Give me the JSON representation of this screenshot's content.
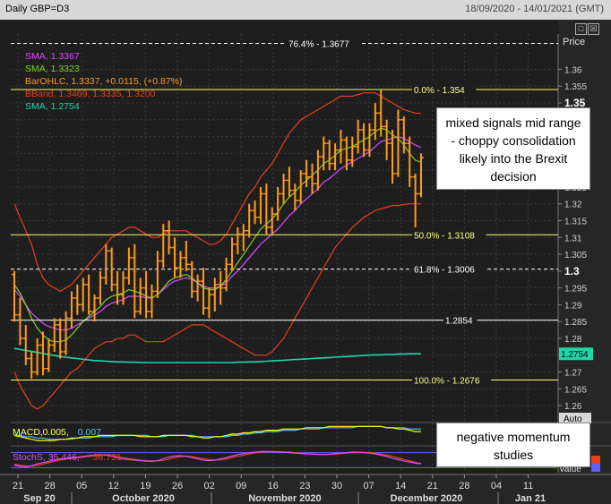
{
  "header": {
    "title": "Daily GBP=D3",
    "date_range": "18/09/2020 - 14/01/2021 (GMT)"
  },
  "window_buttons": [
    "□",
    "☒"
  ],
  "annotations": {
    "main": "mixed signals mid range - choppy consolidation likely into the Brexit decision",
    "momentum": "negative momentum studies"
  },
  "colors": {
    "background": "#1e1e1e",
    "grid": "#3a3a3a",
    "candle": "#ff9a1a",
    "sma_fast": "#d94cff",
    "sma_slow": "#7fd327",
    "sma_long": "#1fd6a8",
    "bband": "#e8401c",
    "fib_line": "#ffff66",
    "macd": "#ffff00",
    "macd_signal": "#4fc3f7",
    "stoch_k": "#d94cff",
    "stoch_d": "#e8401c"
  },
  "chart_data": {
    "type": "candlestick",
    "title": "Daily GBP=D3",
    "ylabel": "Price",
    "ylim": [
      1.2555,
      1.3705
    ],
    "y_ticks": [
      1.26,
      1.265,
      1.27,
      1.275,
      1.28,
      1.285,
      1.29,
      1.295,
      1.3,
      1.305,
      1.31,
      1.315,
      1.32,
      1.325,
      1.33,
      1.335,
      1.34,
      1.345,
      1.35,
      1.355,
      1.36
    ],
    "y_ticks_labels": [
      "1.26",
      "1.265",
      "1.27",
      "1.275",
      "1.28",
      "1.285",
      "1.29",
      "1.295",
      "1.3",
      "1.305",
      "1.31",
      "1.315",
      "1.32",
      "1.325",
      "1.33",
      "1.335",
      "1.34",
      "1.345",
      "1.35",
      "1.355",
      "1.36"
    ],
    "y_ticks_bold": [
      "1.3",
      "1.35"
    ],
    "x_ticks": [
      "21",
      "28",
      "05",
      "12",
      "19",
      "26",
      "02",
      "09",
      "16",
      "23",
      "30",
      "07",
      "14",
      "21",
      "28",
      "04",
      "11"
    ],
    "x_months": [
      "Sep 20",
      "October 2020",
      "November 2020",
      "December 2020",
      "Jan 21"
    ],
    "legend": [
      {
        "label": "SMA, 1.3367",
        "color": "#d94cff"
      },
      {
        "label": "SMA, 1.3323",
        "color": "#7fd327"
      },
      {
        "label": "BarOHLC, 1.3337, +0.0115, (+0.87%)",
        "color": "#ff9a1a"
      },
      {
        "label": "BBand, 1.3469, 1.3335, 1.3200",
        "color": "#e8401c"
      },
      {
        "label": "SMA, 1.2754",
        "color": "#1fd6a8"
      }
    ],
    "horizontal_levels": [
      {
        "label": "76.4% - 1.3677",
        "value": 1.3677,
        "color": "#ffffff",
        "dashed": true
      },
      {
        "label": "0.0% - 1.354",
        "value": 1.354,
        "color": "#ffff66",
        "dashed": false
      },
      {
        "label": "50.0% - 1.3108",
        "value": 1.3108,
        "color": "#ffff66",
        "dashed": false
      },
      {
        "label": "61.8% - 1.3006",
        "value": 1.3006,
        "color": "#ffffff",
        "dashed": true
      },
      {
        "label": "1.2854",
        "value": 1.2854,
        "color": "#ffffff",
        "dashed": false
      },
      {
        "label": "100.0% - 1.2676",
        "value": 1.2676,
        "color": "#ffff66",
        "dashed": false
      }
    ],
    "last_value_tag": {
      "label": "1.2754",
      "value": 1.2754
    },
    "ohlc": [
      [
        1.299,
        1.3,
        1.285,
        1.287
      ],
      [
        1.287,
        1.292,
        1.278,
        1.28
      ],
      [
        1.28,
        1.284,
        1.272,
        1.274
      ],
      [
        1.274,
        1.276,
        1.268,
        1.27
      ],
      [
        1.27,
        1.28,
        1.269,
        1.278
      ],
      [
        1.278,
        1.282,
        1.269,
        1.271
      ],
      [
        1.271,
        1.28,
        1.27,
        1.278
      ],
      [
        1.278,
        1.286,
        1.276,
        1.284
      ],
      [
        1.284,
        1.286,
        1.274,
        1.276
      ],
      [
        1.276,
        1.288,
        1.275,
        1.286
      ],
      [
        1.286,
        1.294,
        1.283,
        1.292
      ],
      [
        1.292,
        1.296,
        1.287,
        1.29
      ],
      [
        1.29,
        1.298,
        1.288,
        1.296
      ],
      [
        1.296,
        1.299,
        1.287,
        1.288
      ],
      [
        1.288,
        1.293,
        1.285,
        1.292
      ],
      [
        1.292,
        1.3,
        1.29,
        1.298
      ],
      [
        1.298,
        1.308,
        1.296,
        1.306
      ],
      [
        1.306,
        1.307,
        1.294,
        1.296
      ],
      [
        1.296,
        1.3,
        1.29,
        1.293
      ],
      [
        1.293,
        1.3,
        1.29,
        1.298
      ],
      [
        1.298,
        1.307,
        1.296,
        1.304
      ],
      [
        1.304,
        1.308,
        1.286,
        1.288
      ],
      [
        1.288,
        1.298,
        1.287,
        1.295
      ],
      [
        1.295,
        1.3,
        1.286,
        1.288
      ],
      [
        1.288,
        1.296,
        1.286,
        1.294
      ],
      [
        1.294,
        1.306,
        1.292,
        1.303
      ],
      [
        1.303,
        1.314,
        1.301,
        1.312
      ],
      [
        1.312,
        1.315,
        1.305,
        1.307
      ],
      [
        1.307,
        1.31,
        1.298,
        1.301
      ],
      [
        1.301,
        1.306,
        1.298,
        1.304
      ],
      [
        1.304,
        1.309,
        1.3,
        1.302
      ],
      [
        1.302,
        1.303,
        1.292,
        1.294
      ],
      [
        1.294,
        1.299,
        1.291,
        1.297
      ],
      [
        1.297,
        1.301,
        1.287,
        1.289
      ],
      [
        1.289,
        1.295,
        1.286,
        1.293
      ],
      [
        1.293,
        1.298,
        1.288,
        1.296
      ],
      [
        1.296,
        1.3,
        1.29,
        1.295
      ],
      [
        1.295,
        1.304,
        1.294,
        1.302
      ],
      [
        1.302,
        1.31,
        1.3,
        1.308
      ],
      [
        1.308,
        1.313,
        1.305,
        1.311
      ],
      [
        1.311,
        1.314,
        1.306,
        1.312
      ],
      [
        1.312,
        1.32,
        1.31,
        1.318
      ],
      [
        1.318,
        1.321,
        1.314,
        1.316
      ],
      [
        1.316,
        1.325,
        1.314,
        1.323
      ],
      [
        1.323,
        1.326,
        1.311,
        1.313
      ],
      [
        1.313,
        1.319,
        1.311,
        1.317
      ],
      [
        1.317,
        1.325,
        1.315,
        1.323
      ],
      [
        1.323,
        1.329,
        1.32,
        1.327
      ],
      [
        1.327,
        1.331,
        1.322,
        1.324
      ],
      [
        1.324,
        1.326,
        1.318,
        1.321
      ],
      [
        1.321,
        1.33,
        1.32,
        1.329
      ],
      [
        1.329,
        1.333,
        1.325,
        1.328
      ],
      [
        1.328,
        1.332,
        1.323,
        1.326
      ],
      [
        1.326,
        1.336,
        1.324,
        1.334
      ],
      [
        1.334,
        1.34,
        1.33,
        1.338
      ],
      [
        1.338,
        1.339,
        1.33,
        1.332
      ],
      [
        1.332,
        1.338,
        1.33,
        1.336
      ],
      [
        1.336,
        1.342,
        1.332,
        1.339
      ],
      [
        1.339,
        1.34,
        1.33,
        1.333
      ],
      [
        1.333,
        1.34,
        1.331,
        1.337
      ],
      [
        1.337,
        1.345,
        1.335,
        1.342
      ],
      [
        1.342,
        1.344,
        1.334,
        1.336
      ],
      [
        1.336,
        1.344,
        1.334,
        1.342
      ],
      [
        1.342,
        1.35,
        1.339,
        1.347
      ],
      [
        1.347,
        1.354,
        1.34,
        1.343
      ],
      [
        1.343,
        1.345,
        1.333,
        1.338
      ],
      [
        1.338,
        1.342,
        1.326,
        1.329
      ],
      [
        1.329,
        1.348,
        1.328,
        1.345
      ],
      [
        1.345,
        1.346,
        1.335,
        1.338
      ],
      [
        1.338,
        1.34,
        1.325,
        1.328
      ],
      [
        1.328,
        1.329,
        1.313,
        1.323
      ],
      [
        1.323,
        1.335,
        1.322,
        1.3337
      ]
    ],
    "sma_fast": [
      1.2945,
      1.2925,
      1.29,
      1.2875,
      1.286,
      1.2845,
      1.2835,
      1.283,
      1.2825,
      1.2825,
      1.283,
      1.284,
      1.285,
      1.286,
      1.287,
      1.288,
      1.2895,
      1.2905,
      1.291,
      1.2915,
      1.2925,
      1.2925,
      1.2925,
      1.292,
      1.292,
      1.293,
      1.2945,
      1.296,
      1.297,
      1.2975,
      1.298,
      1.2975,
      1.2965,
      1.2955,
      1.295,
      1.295,
      1.2955,
      1.2965,
      1.2985,
      1.3,
      1.302,
      1.304,
      1.306,
      1.308,
      1.3095,
      1.311,
      1.3125,
      1.3145,
      1.3165,
      1.318,
      1.32,
      1.3215,
      1.323,
      1.3245,
      1.3265,
      1.3275,
      1.329,
      1.3305,
      1.3315,
      1.3325,
      1.3335,
      1.3345,
      1.3355,
      1.337,
      1.3385,
      1.339,
      1.3395,
      1.34,
      1.3395,
      1.3385,
      1.3375,
      1.3367
    ],
    "sma_slow": [
      1.296,
      1.2935,
      1.29,
      1.286,
      1.283,
      1.281,
      1.2795,
      1.279,
      1.279,
      1.2795,
      1.281,
      1.283,
      1.285,
      1.2865,
      1.288,
      1.2895,
      1.2915,
      1.2925,
      1.293,
      1.2935,
      1.2945,
      1.294,
      1.2935,
      1.2925,
      1.292,
      1.293,
      1.295,
      1.297,
      1.298,
      1.2985,
      1.299,
      1.298,
      1.2965,
      1.295,
      1.2945,
      1.2945,
      1.2955,
      1.2975,
      1.3,
      1.3025,
      1.305,
      1.3075,
      1.31,
      1.3125,
      1.314,
      1.3155,
      1.3175,
      1.32,
      1.322,
      1.3235,
      1.3255,
      1.327,
      1.3285,
      1.33,
      1.332,
      1.333,
      1.3345,
      1.336,
      1.3365,
      1.337,
      1.338,
      1.339,
      1.34,
      1.3415,
      1.3425,
      1.342,
      1.3405,
      1.3395,
      1.3375,
      1.335,
      1.333,
      1.3323
    ],
    "sma_long": [
      1.277,
      1.2767,
      1.2764,
      1.2761,
      1.2758,
      1.2755,
      1.2752,
      1.2749,
      1.2746,
      1.2744,
      1.2742,
      1.274,
      1.2738,
      1.2736,
      1.2734,
      1.2733,
      1.2732,
      1.2731,
      1.273,
      1.273,
      1.2729,
      1.2729,
      1.2728,
      1.2728,
      1.2728,
      1.2728,
      1.2728,
      1.2728,
      1.2728,
      1.2728,
      1.2728,
      1.2728,
      1.2728,
      1.2728,
      1.2728,
      1.2728,
      1.2728,
      1.2728,
      1.2728,
      1.2729,
      1.2729,
      1.273,
      1.273,
      1.2731,
      1.2732,
      1.2733,
      1.2734,
      1.2735,
      1.2736,
      1.2737,
      1.2738,
      1.2739,
      1.274,
      1.2741,
      1.2742,
      1.2743,
      1.2744,
      1.2745,
      1.2746,
      1.2747,
      1.2748,
      1.2749,
      1.275,
      1.2751,
      1.2751,
      1.2752,
      1.2752,
      1.2753,
      1.2753,
      1.2754,
      1.2754,
      1.2754
    ],
    "bb_upper": [
      1.32,
      1.316,
      1.312,
      1.308,
      1.302,
      1.298,
      1.296,
      1.295,
      1.294,
      1.295,
      1.296,
      1.298,
      1.3,
      1.302,
      1.304,
      1.306,
      1.308,
      1.31,
      1.311,
      1.312,
      1.313,
      1.313,
      1.312,
      1.311,
      1.31,
      1.31,
      1.311,
      1.312,
      1.312,
      1.312,
      1.312,
      1.311,
      1.31,
      1.309,
      1.308,
      1.308,
      1.309,
      1.311,
      1.314,
      1.317,
      1.32,
      1.323,
      1.325,
      1.328,
      1.33,
      1.332,
      1.335,
      1.338,
      1.341,
      1.343,
      1.345,
      1.346,
      1.347,
      1.348,
      1.349,
      1.35,
      1.351,
      1.352,
      1.352,
      1.352,
      1.3525,
      1.353,
      1.353,
      1.353,
      1.352,
      1.351,
      1.35,
      1.349,
      1.348,
      1.3475,
      1.347,
      1.3469
    ],
    "bb_lower": [
      1.27,
      1.266,
      1.263,
      1.26,
      1.259,
      1.26,
      1.262,
      1.264,
      1.266,
      1.268,
      1.27,
      1.271,
      1.273,
      1.275,
      1.277,
      1.278,
      1.279,
      1.279,
      1.28,
      1.28,
      1.281,
      1.281,
      1.28,
      1.279,
      1.279,
      1.279,
      1.279,
      1.28,
      1.281,
      1.282,
      1.283,
      1.284,
      1.284,
      1.284,
      1.283,
      1.282,
      1.281,
      1.28,
      1.279,
      1.278,
      1.277,
      1.276,
      1.275,
      1.275,
      1.275,
      1.276,
      1.278,
      1.28,
      1.283,
      1.286,
      1.289,
      1.292,
      1.295,
      1.298,
      1.301,
      1.304,
      1.307,
      1.309,
      1.311,
      1.313,
      1.3145,
      1.316,
      1.317,
      1.318,
      1.3185,
      1.319,
      1.3195,
      1.3195,
      1.3198,
      1.32,
      1.32,
      1.32
    ],
    "macd_panel": {
      "label": "MACD, 0.005, 0.007",
      "values": [
        0.002,
        0.001,
        0.0,
        -0.001,
        -0.002,
        -0.002,
        -0.002,
        -0.002,
        -0.001,
        -0.001,
        0.0,
        0.0,
        0.001,
        0.001,
        0.001,
        0.002,
        0.002,
        0.002,
        0.002,
        0.002,
        0.002,
        0.002,
        0.001,
        0.001,
        0.001,
        0.001,
        0.002,
        0.002,
        0.002,
        0.002,
        0.002,
        0.001,
        0.001,
        0.0,
        0.0,
        0.001,
        0.001,
        0.002,
        0.003,
        0.003,
        0.004,
        0.004,
        0.005,
        0.005,
        0.006,
        0.006,
        0.006,
        0.007,
        0.007,
        0.007,
        0.007,
        0.008,
        0.008,
        0.008,
        0.008,
        0.009,
        0.009,
        0.009,
        0.009,
        0.009,
        0.009,
        0.009,
        0.009,
        0.009,
        0.009,
        0.008,
        0.008,
        0.007,
        0.007,
        0.006,
        0.005,
        0.005
      ],
      "signal": [
        0.002,
        0.002,
        0.001,
        0.001,
        0.0,
        0.0,
        -0.001,
        -0.001,
        -0.001,
        -0.001,
        -0.001,
        0.0,
        0.0,
        0.0,
        0.001,
        0.001,
        0.001,
        0.001,
        0.002,
        0.002,
        0.002,
        0.002,
        0.002,
        0.002,
        0.001,
        0.001,
        0.001,
        0.002,
        0.002,
        0.002,
        0.002,
        0.002,
        0.001,
        0.001,
        0.001,
        0.001,
        0.001,
        0.001,
        0.002,
        0.002,
        0.003,
        0.003,
        0.004,
        0.004,
        0.005,
        0.005,
        0.005,
        0.006,
        0.006,
        0.006,
        0.007,
        0.007,
        0.007,
        0.007,
        0.008,
        0.008,
        0.008,
        0.008,
        0.008,
        0.008,
        0.009,
        0.009,
        0.009,
        0.009,
        0.009,
        0.008,
        0.008,
        0.008,
        0.008,
        0.007,
        0.007,
        0.007
      ],
      "ylim": [
        -0.004,
        0.012
      ]
    },
    "stoch_panel": {
      "label": "StochS, 35.446, 36.731",
      "k": [
        30,
        25,
        22,
        28,
        35,
        40,
        45,
        50,
        55,
        58,
        60,
        62,
        65,
        68,
        70,
        72,
        70,
        66,
        60,
        55,
        52,
        50,
        48,
        46,
        45,
        48,
        55,
        62,
        66,
        68,
        65,
        60,
        55,
        50,
        48,
        50,
        55,
        60,
        66,
        72,
        76,
        80,
        82,
        84,
        85,
        84,
        83,
        82,
        80,
        78,
        76,
        75,
        74,
        73,
        72,
        74,
        76,
        78,
        80,
        82,
        82,
        80,
        78,
        75,
        70,
        65,
        58,
        52,
        46,
        42,
        38,
        35.446
      ],
      "d": [
        34,
        30,
        27,
        26,
        29,
        34,
        40,
        45,
        50,
        54,
        57,
        60,
        62,
        65,
        67,
        69,
        70,
        68,
        64,
        60,
        56,
        53,
        50,
        48,
        47,
        47,
        49,
        54,
        60,
        64,
        66,
        64,
        60,
        56,
        52,
        50,
        51,
        55,
        60,
        65,
        70,
        75,
        79,
        82,
        83,
        84,
        84,
        83,
        82,
        80,
        78,
        76,
        75,
        74,
        73,
        73,
        74,
        76,
        78,
        80,
        81,
        81,
        80,
        78,
        74,
        70,
        65,
        59,
        53,
        47,
        41,
        36.731
      ],
      "ylim": [
        0,
        100
      ],
      "levels": [
        20,
        80
      ]
    },
    "axis_tags": {
      "macd_panel": "Auto",
      "stoch_panel": "Value"
    }
  }
}
